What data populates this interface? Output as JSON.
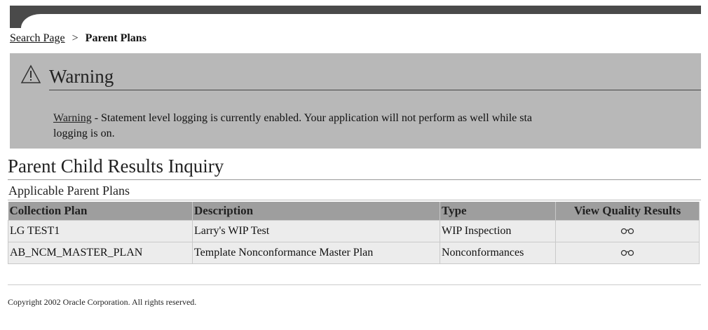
{
  "breadcrumb": {
    "link": "Search Page",
    "separator": ">",
    "current": "Parent Plans"
  },
  "warning": {
    "title": "Warning",
    "label": "Warning",
    "dash": "-",
    "message_line1": "Statement level logging is currently enabled. Your application will not perform as well while sta",
    "message_line2": "logging is on.",
    "icon": "warning-triangle-icon"
  },
  "page": {
    "title": "Parent Child Results Inquiry",
    "subtitle": "Applicable Parent Plans"
  },
  "table": {
    "headers": [
      "Collection Plan",
      "Description",
      "Type",
      "View Quality Results"
    ],
    "rows": [
      {
        "plan": "LG TEST1",
        "description": "Larry's WIP Test",
        "type": "WIP Inspection",
        "view_icon": "glasses-icon"
      },
      {
        "plan": "AB_NCM_MASTER_PLAN",
        "description": "Template Nonconformance Master Plan",
        "type": "Nonconformances",
        "view_icon": "glasses-icon"
      }
    ]
  },
  "footer": {
    "copyright": "Copyright 2002 Oracle Corporation. All rights reserved."
  },
  "colors": {
    "header_bar": "#4a4a4a",
    "warning_bg": "#b8b8b8",
    "table_header_bg": "#9e9e9e",
    "table_row_bg": "#ececec"
  }
}
